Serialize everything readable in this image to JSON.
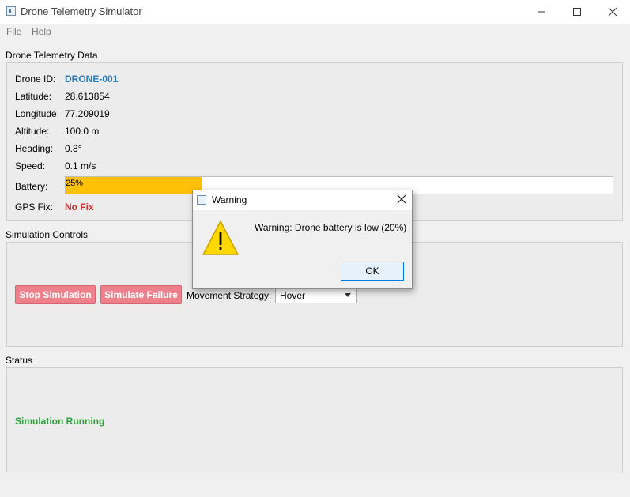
{
  "window": {
    "title": "Drone Telemetry Simulator"
  },
  "menu": {
    "items": [
      "File",
      "Help"
    ]
  },
  "telemetry": {
    "group_title": "Drone Telemetry Data",
    "drone_id_label": "Drone ID:",
    "drone_id": "DRONE-001",
    "latitude_label": "Latitude:",
    "latitude": "28.613854",
    "longitude_label": "Longitude:",
    "longitude": "77.209019",
    "altitude_label": "Altitude:",
    "altitude": "100.0 m",
    "heading_label": "Heading:",
    "heading": "0.8°",
    "speed_label": "Speed:",
    "speed": "0.1 m/s",
    "battery_label": "Battery:",
    "battery_text": "25%",
    "battery_percent": 25,
    "battery_color": "#ffc107",
    "gps_label": "GPS Fix:",
    "gps_value": "No Fix",
    "drone_id_color": "#2a7ab8",
    "gps_color": "#d62f2f"
  },
  "controls": {
    "group_title": "Simulation Controls",
    "stop_label": "Stop Simulation",
    "failure_label": "Simulate Failure",
    "strategy_label": "Movement Strategy:",
    "strategy_selected": "Hover",
    "button_color": "#ef7f8a"
  },
  "status": {
    "group_title": "Status",
    "text": "Simulation Running",
    "color": "#2e9e3e"
  },
  "dialog": {
    "title": "Warning",
    "message": "Warning: Drone battery is low (20%)",
    "ok_label": "OK",
    "icon": "warning-icon"
  }
}
